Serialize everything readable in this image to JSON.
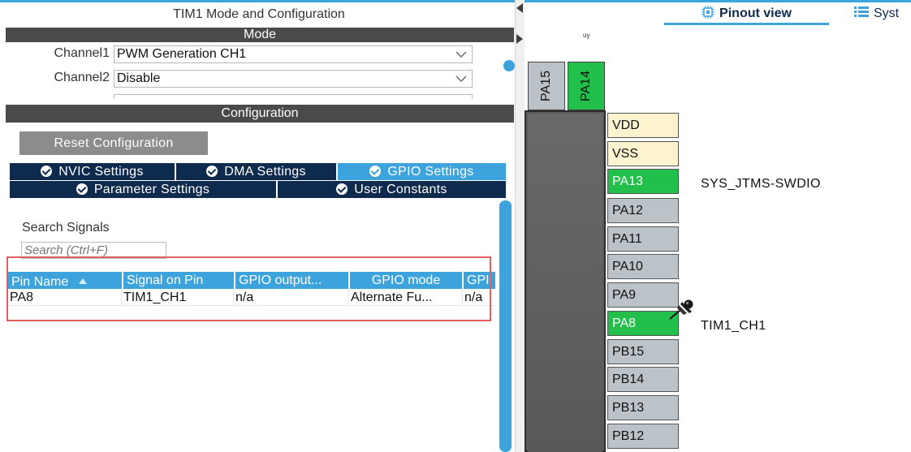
{
  "left_panel": {
    "title": "TIM1 Mode and Configuration",
    "mode_header": "Mode",
    "channels": [
      {
        "label": "Channel1",
        "value": "PWM Generation CH1"
      },
      {
        "label": "Channel2",
        "value": "Disable"
      }
    ],
    "config_header": "Configuration",
    "reset_button": "Reset Configuration",
    "tabs_row1": [
      {
        "label": "NVIC Settings",
        "active": false
      },
      {
        "label": "DMA Settings",
        "active": false
      },
      {
        "label": "GPIO Settings",
        "active": true
      }
    ],
    "tabs_row2": [
      {
        "label": "Parameter Settings",
        "active": false
      },
      {
        "label": "User Constants",
        "active": false
      }
    ],
    "search_label": "Search Signals",
    "search_placeholder": "Search (Ctrl+F)",
    "table": {
      "headers": [
        "Pin Name",
        "Signal on Pin",
        "GPIO output...",
        "GPIO mode",
        "GPI"
      ],
      "rows": [
        [
          "PA8",
          "TIM1_CH1",
          "n/a",
          "Alternate Fu...",
          "n/a"
        ]
      ]
    }
  },
  "right_panel": {
    "pinout_tab": "Pinout view",
    "system_tab": "Syst",
    "top_fragment": "ᵘʸ",
    "top_pins": [
      {
        "name": "PA15",
        "state": "gray"
      },
      {
        "name": "PA14",
        "state": "green"
      }
    ],
    "side_pins": [
      {
        "name": "VDD",
        "state": "yellow",
        "signal": ""
      },
      {
        "name": "VSS",
        "state": "yellow",
        "signal": ""
      },
      {
        "name": "PA13",
        "state": "green",
        "signal": "SYS_JTMS-SWDIO"
      },
      {
        "name": "PA12",
        "state": "gray",
        "signal": ""
      },
      {
        "name": "PA11",
        "state": "gray",
        "signal": ""
      },
      {
        "name": "PA10",
        "state": "gray",
        "signal": ""
      },
      {
        "name": "PA9",
        "state": "gray",
        "signal": ""
      },
      {
        "name": "PA8",
        "state": "green",
        "signal": "TIM1_CH1"
      },
      {
        "name": "PB15",
        "state": "gray",
        "signal": ""
      },
      {
        "name": "PB14",
        "state": "gray",
        "signal": ""
      },
      {
        "name": "PB13",
        "state": "gray",
        "signal": ""
      },
      {
        "name": "PB12",
        "state": "gray",
        "signal": ""
      }
    ]
  },
  "colors": {
    "accent_blue": "#3da3dc",
    "dark_navy": "#0e2a4d",
    "pin_green": "#22bf4a",
    "pin_gray": "#bcc3c8",
    "pin_yellow": "#fdf3cf",
    "highlight_red": "#e06060"
  },
  "icons": {
    "pinout_tab": "chip-icon",
    "system_tab": "list-icon",
    "pin_lock": "pushpin-icon",
    "tab_check": "check-circle-icon",
    "dropdown": "chevron-down-icon",
    "sort": "sort-up-icon"
  }
}
